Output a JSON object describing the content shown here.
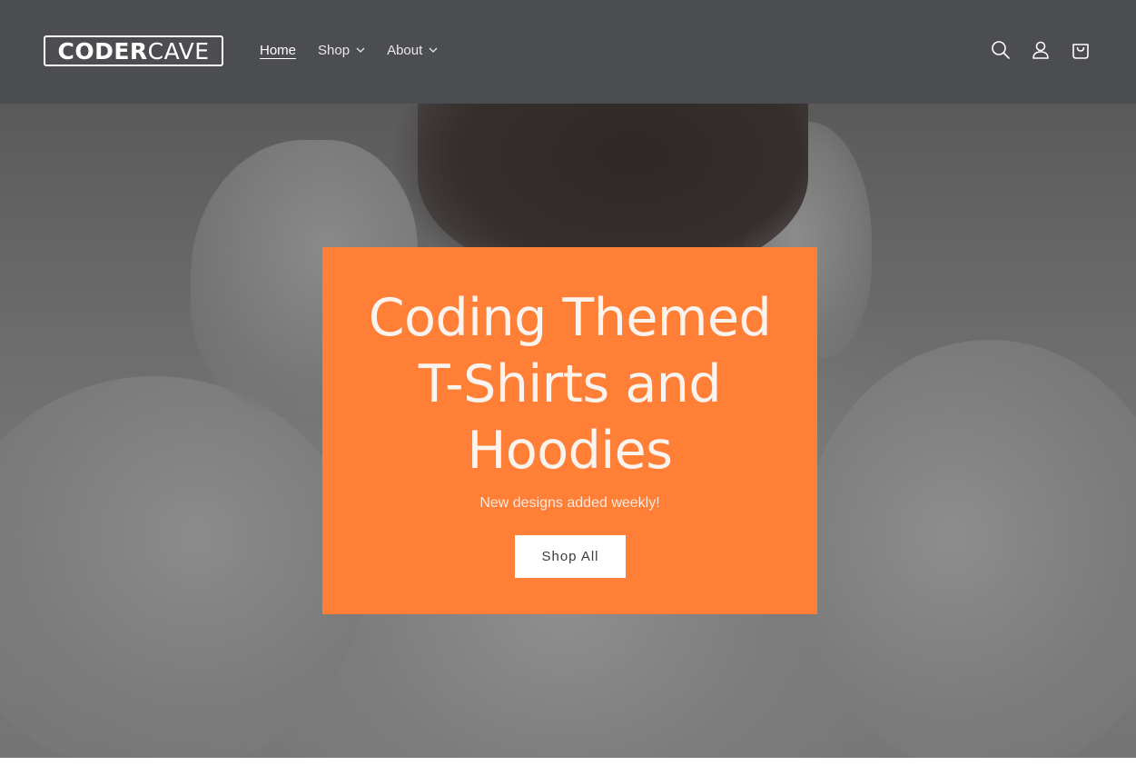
{
  "brand": {
    "logo_bold": "CODER",
    "logo_light": "CAVE"
  },
  "nav": {
    "items": [
      {
        "label": "Home"
      },
      {
        "label": "Shop"
      },
      {
        "label": "About"
      }
    ]
  },
  "header_icons": [
    "search-icon",
    "account-icon",
    "cart-icon"
  ],
  "hero": {
    "title_lines": [
      "Coding Themed",
      "T-Shirts and",
      "Hoodies"
    ],
    "subtitle": "New designs added weekly!",
    "cta_label": "Shop All"
  },
  "colors": {
    "header_bg": "#4c4d50",
    "banner_bg": "#ff7f37",
    "cta_bg": "#ffffff"
  }
}
